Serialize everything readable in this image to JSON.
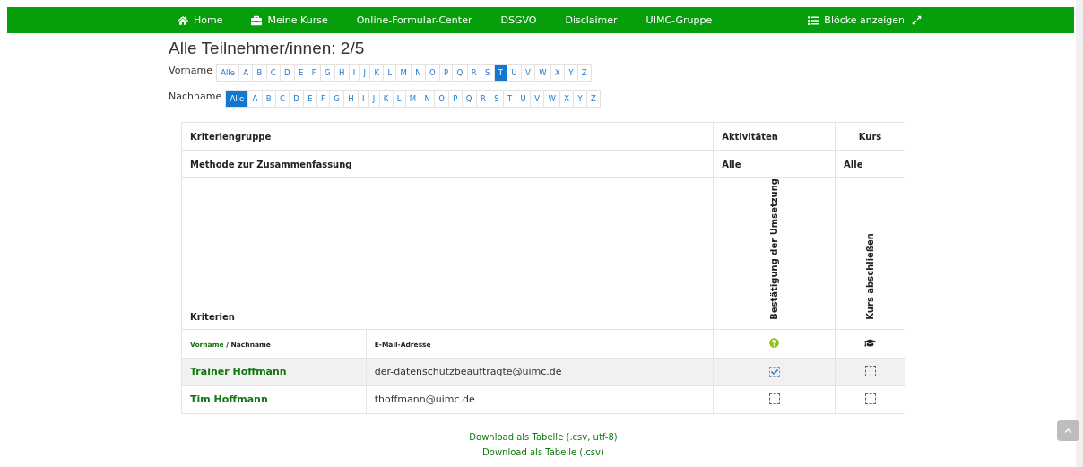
{
  "nav": {
    "items": [
      {
        "label": "Home",
        "kind": "home"
      },
      {
        "label": "Meine Kurse",
        "kind": "courses"
      },
      {
        "label": "Online-Formular-Center",
        "kind": "plain"
      },
      {
        "label": "DSGVO",
        "kind": "plain"
      },
      {
        "label": "Disclaimer",
        "kind": "plain"
      },
      {
        "label": "UIMC-Gruppe",
        "kind": "plain"
      }
    ],
    "blocks_button": "Blöcke anzeigen"
  },
  "title": "Alle Teilnehmer/innen: 2/5",
  "filters": [
    {
      "label": "Vorname",
      "letters": [
        {
          "label": "Alle",
          "selected": false
        },
        {
          "label": "A",
          "selected": false
        },
        {
          "label": "B",
          "selected": false
        },
        {
          "label": "C",
          "selected": false
        },
        {
          "label": "D",
          "selected": false
        },
        {
          "label": "E",
          "selected": false
        },
        {
          "label": "F",
          "selected": false
        },
        {
          "label": "G",
          "selected": false
        },
        {
          "label": "H",
          "selected": false
        },
        {
          "label": "I",
          "selected": false
        },
        {
          "label": "J",
          "selected": false
        },
        {
          "label": "K",
          "selected": false
        },
        {
          "label": "L",
          "selected": false
        },
        {
          "label": "M",
          "selected": false
        },
        {
          "label": "N",
          "selected": false
        },
        {
          "label": "O",
          "selected": false
        },
        {
          "label": "P",
          "selected": false
        },
        {
          "label": "Q",
          "selected": false
        },
        {
          "label": "R",
          "selected": false
        },
        {
          "label": "S",
          "selected": false
        },
        {
          "label": "T",
          "selected": true
        },
        {
          "label": "U",
          "selected": false
        },
        {
          "label": "V",
          "selected": false
        },
        {
          "label": "W",
          "selected": false
        },
        {
          "label": "X",
          "selected": false
        },
        {
          "label": "Y",
          "selected": false
        },
        {
          "label": "Z",
          "selected": false
        }
      ]
    },
    {
      "label": "Nachname",
      "letters": [
        {
          "label": "Alle",
          "selected": true
        },
        {
          "label": "A",
          "selected": false
        },
        {
          "label": "B",
          "selected": false
        },
        {
          "label": "C",
          "selected": false
        },
        {
          "label": "D",
          "selected": false
        },
        {
          "label": "E",
          "selected": false
        },
        {
          "label": "F",
          "selected": false
        },
        {
          "label": "G",
          "selected": false
        },
        {
          "label": "H",
          "selected": false
        },
        {
          "label": "I",
          "selected": false
        },
        {
          "label": "J",
          "selected": false
        },
        {
          "label": "K",
          "selected": false
        },
        {
          "label": "L",
          "selected": false
        },
        {
          "label": "M",
          "selected": false
        },
        {
          "label": "N",
          "selected": false
        },
        {
          "label": "O",
          "selected": false
        },
        {
          "label": "P",
          "selected": false
        },
        {
          "label": "Q",
          "selected": false
        },
        {
          "label": "R",
          "selected": false
        },
        {
          "label": "S",
          "selected": false
        },
        {
          "label": "T",
          "selected": false
        },
        {
          "label": "U",
          "selected": false
        },
        {
          "label": "V",
          "selected": false
        },
        {
          "label": "W",
          "selected": false
        },
        {
          "label": "X",
          "selected": false
        },
        {
          "label": "Y",
          "selected": false
        },
        {
          "label": "Z",
          "selected": false
        }
      ]
    }
  ],
  "table": {
    "group_row": {
      "label": "Kriteriengruppe",
      "activity": "Aktivitäten",
      "course": "Kurs"
    },
    "method_row": {
      "label": "Methode zur Zusammenfassung",
      "activity": "Alle",
      "course": "Alle"
    },
    "criteria_row": {
      "label": "Kriterien",
      "activity": "Bestätigung der Umsetzung",
      "course": "Kurs abschließen"
    },
    "columns": {
      "first_name": "Vorname",
      "separator": " / ",
      "last_name": "Nachname",
      "email": "E-Mail-Adresse"
    },
    "rows": [
      {
        "name": "Trainer Hoffmann",
        "email": "der-datenschutzbeauftragte@uimc.de",
        "activity_checked": true,
        "course_checked": false,
        "highlighted": true
      },
      {
        "name": "Tim Hoffmann",
        "email": "thoffmann@uimc.de",
        "activity_checked": false,
        "course_checked": false,
        "highlighted": false
      }
    ]
  },
  "downloads": [
    "Download als Tabelle (.csv, utf-8)",
    "Download als Tabelle (.csv)"
  ]
}
